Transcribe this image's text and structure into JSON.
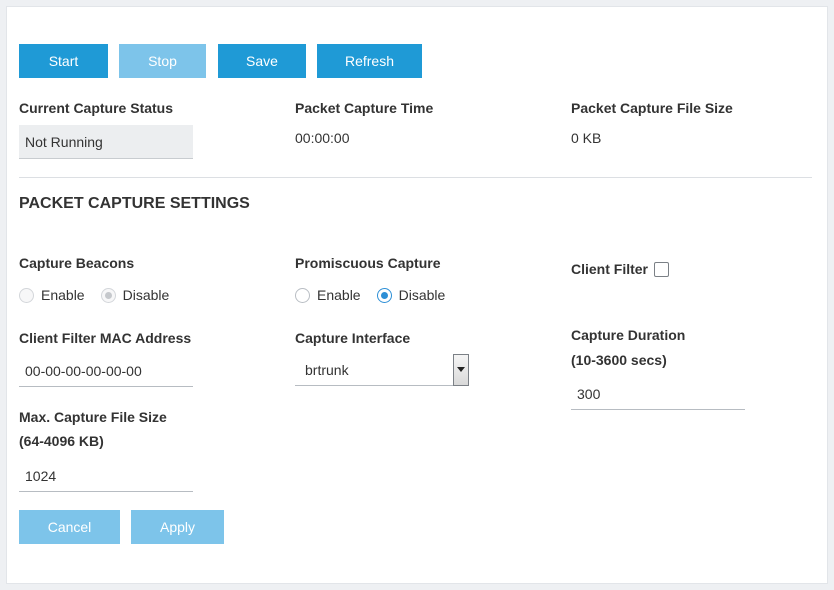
{
  "toolbar": {
    "start": "Start",
    "stop": "Stop",
    "save": "Save",
    "refresh": "Refresh"
  },
  "status": {
    "current_capture_label": "Current Capture Status",
    "current_capture_value": "Not Running",
    "time_label": "Packet Capture Time",
    "time_value": "00:00:00",
    "size_label": "Packet Capture File Size",
    "size_value": "0 KB"
  },
  "settings": {
    "title": "PACKET CAPTURE SETTINGS",
    "beacons": {
      "label": "Capture Beacons",
      "enable": "Enable",
      "disable": "Disable"
    },
    "promiscuous": {
      "label": "Promiscuous Capture",
      "enable": "Enable",
      "disable": "Disable"
    },
    "client_filter": {
      "label": "Client Filter"
    },
    "mac": {
      "label": "Client Filter MAC Address",
      "value": "00-00-00-00-00-00"
    },
    "interface": {
      "label": "Capture Interface",
      "value": "brtrunk"
    },
    "duration": {
      "label": "Capture Duration",
      "sublabel": "(10-3600 secs)",
      "value": "300"
    },
    "max_size": {
      "label": "Max. Capture File Size",
      "sublabel": "(64-4096 KB)",
      "value": "1024"
    }
  },
  "footer": {
    "cancel": "Cancel",
    "apply": "Apply"
  },
  "colors": {
    "primary": "#1f9ad6",
    "primary_disabled": "#7dc4ea",
    "radio_selected": "#2d8fd6"
  }
}
